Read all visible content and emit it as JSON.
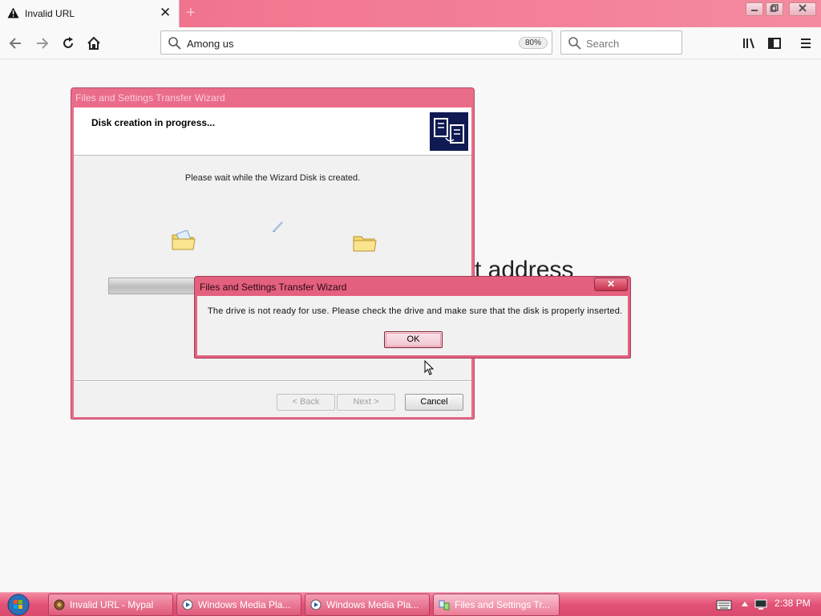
{
  "browser": {
    "tab_title": "Invalid URL",
    "url_text": "Among us",
    "zoom": "80%",
    "search_placeholder": "Search",
    "tab_close": "✕",
    "new_tab": "+"
  },
  "page": {
    "background_text": "t address"
  },
  "wizard": {
    "title": "Files and Settings Transfer Wizard",
    "header_title": "Disk creation in progress...",
    "wait_message": "Please wait while the Wizard Disk is created.",
    "progress": 0.26,
    "back_label": "< Back",
    "next_label": "Next >",
    "cancel_label": "Cancel"
  },
  "dialog": {
    "title": "Files and Settings Transfer Wizard",
    "message": "The drive is not ready for use. Please check the drive and make sure that the disk is properly inserted.",
    "ok_label": "OK",
    "close_glyph": "✕"
  },
  "taskbar": {
    "items": [
      {
        "label": "Invalid URL - Mypal",
        "icon": "browser-icon"
      },
      {
        "label": "Windows Media Pla...",
        "icon": "media-player-icon"
      },
      {
        "label": "Windows Media Pla...",
        "icon": "media-player-icon"
      },
      {
        "label": "Files and Settings Tr...",
        "icon": "wizard-icon"
      }
    ],
    "clock": "2:38 PM"
  },
  "colors": {
    "accent": "#e8607f",
    "title_bar": "#f06a88"
  }
}
